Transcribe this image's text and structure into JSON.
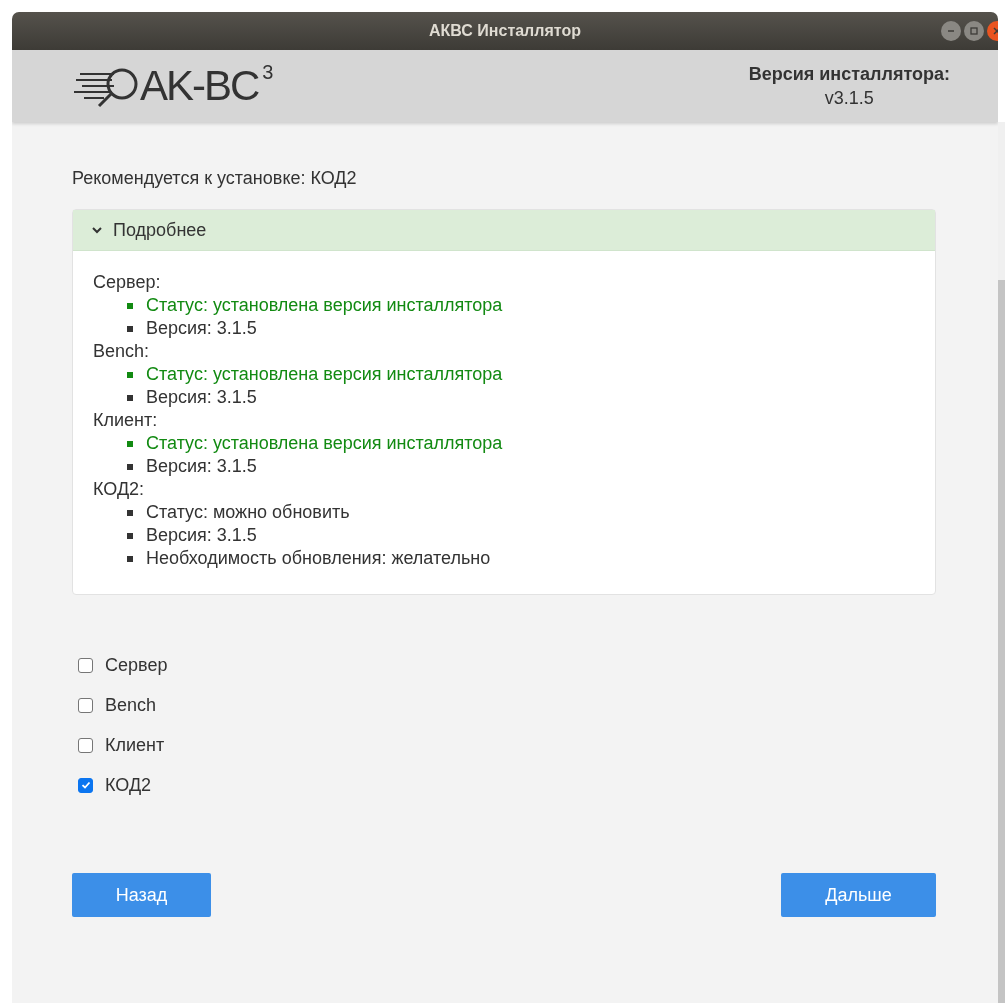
{
  "window": {
    "title": "АКВС Инсталлятор"
  },
  "header": {
    "logo_text": "AK-BC",
    "logo_sup": "3",
    "version_label": "Версия инсталлятора:",
    "version": "v3.1.5"
  },
  "recommendation": "Рекомендуется к установке: КОД2",
  "details": {
    "title": "Подробнее",
    "expanded": true,
    "components": [
      {
        "name": "Сервер:",
        "items": [
          {
            "text": "Статус: установлена версия инсталлятора",
            "kind": "success"
          },
          {
            "text": "Версия: 3.1.5",
            "kind": "plain"
          }
        ]
      },
      {
        "name": "Bench:",
        "items": [
          {
            "text": "Статус: установлена версия инсталлятора",
            "kind": "success"
          },
          {
            "text": "Версия: 3.1.5",
            "kind": "plain"
          }
        ]
      },
      {
        "name": "Клиент:",
        "items": [
          {
            "text": "Статус: установлена версия инсталлятора",
            "kind": "success"
          },
          {
            "text": "Версия: 3.1.5",
            "kind": "plain"
          }
        ]
      },
      {
        "name": "КОД2:",
        "items": [
          {
            "text": "Статус: можно обновить",
            "kind": "plain"
          },
          {
            "text": "Версия: 3.1.5",
            "kind": "plain"
          },
          {
            "text": "Необходимость обновления: желательно",
            "kind": "plain"
          }
        ]
      }
    ]
  },
  "options": [
    {
      "label": "Сервер",
      "checked": false
    },
    {
      "label": "Bench",
      "checked": false
    },
    {
      "label": "Клиент",
      "checked": false
    },
    {
      "label": "КОД2",
      "checked": true
    }
  ],
  "buttons": {
    "back": "Назад",
    "next": "Дальше"
  }
}
